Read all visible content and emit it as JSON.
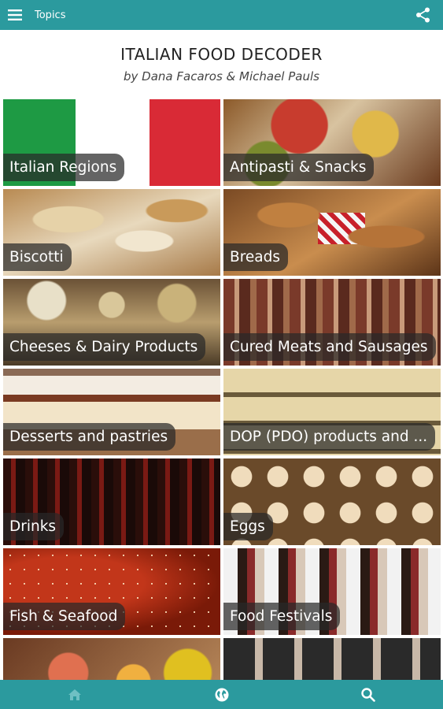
{
  "appbar": {
    "title": "Topics",
    "menu_icon": "menu-icon",
    "share_icon": "share-icon"
  },
  "header": {
    "title": "ITALIAN FOOD DECODER",
    "subtitle": "by Dana Facaros & Michael Pauls"
  },
  "topics": [
    {
      "label": "Italian Regions"
    },
    {
      "label": "Antipasti & Snacks"
    },
    {
      "label": "Biscotti"
    },
    {
      "label": "Breads"
    },
    {
      "label": "Cheeses & Dairy Products"
    },
    {
      "label": "Cured Meats and Sausages"
    },
    {
      "label": "Desserts and pastries"
    },
    {
      "label": "DOP (PDO) products and ..."
    },
    {
      "label": "Drinks"
    },
    {
      "label": "Eggs"
    },
    {
      "label": "Fish & Seafood"
    },
    {
      "label": "Food Festivals"
    }
  ],
  "bottom_nav": {
    "home_icon": "home-icon",
    "globe_icon": "globe-icon",
    "search_icon": "search-icon"
  },
  "colors": {
    "accent": "#2b9a9e",
    "flag_green": "#1e9a44",
    "flag_red": "#d92a36"
  }
}
